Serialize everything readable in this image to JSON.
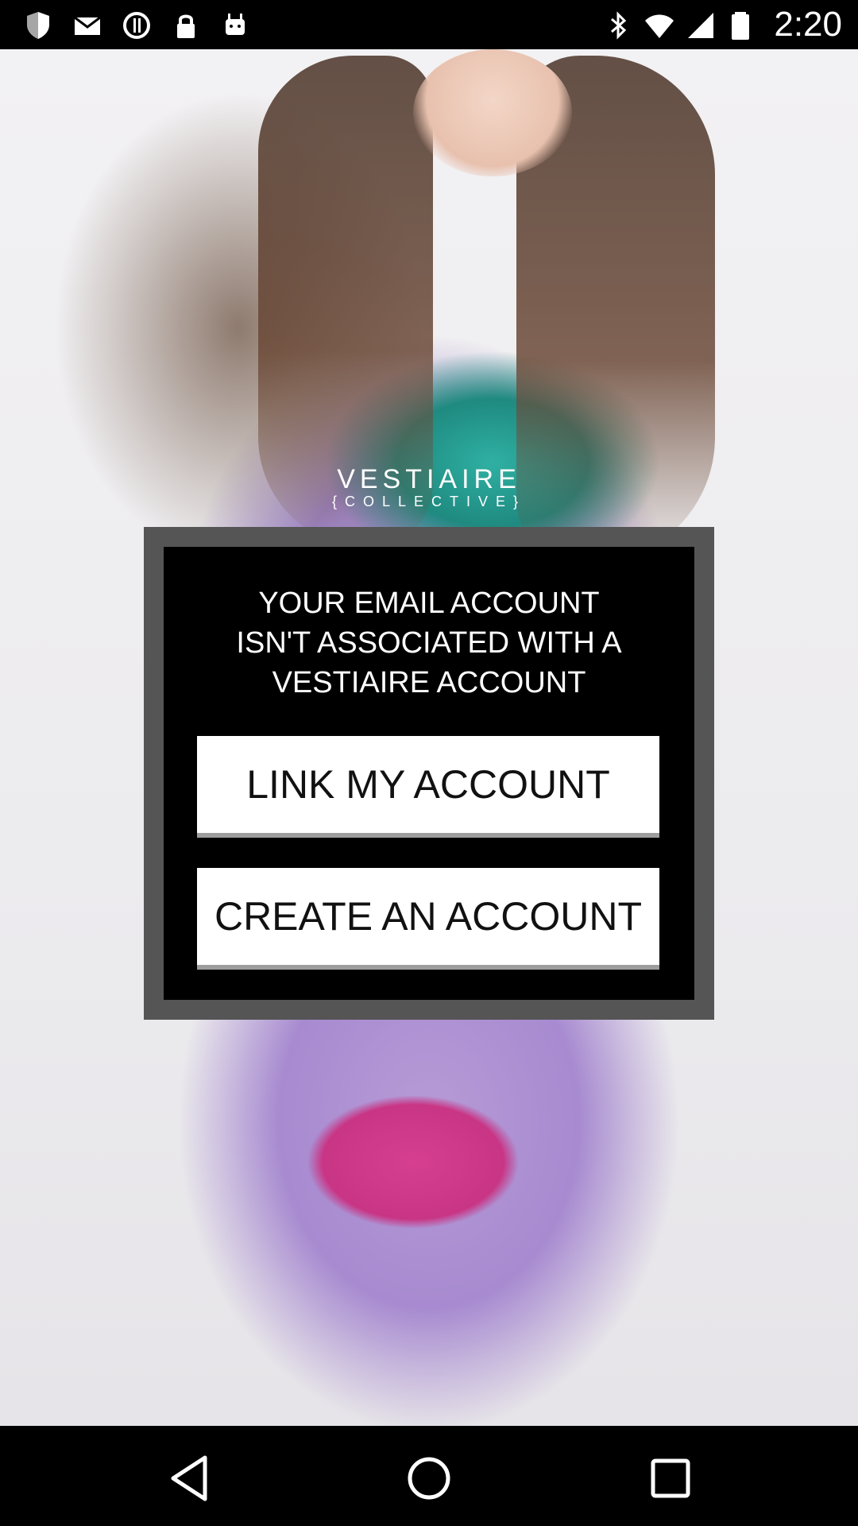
{
  "status_bar": {
    "time": "2:20",
    "icons_left": [
      "shield-icon",
      "email-icon",
      "sync-icon",
      "lock-icon",
      "android-icon"
    ],
    "icons_right": [
      "bluetooth-icon",
      "wifi-icon",
      "signal-icon",
      "battery-icon"
    ]
  },
  "brand": {
    "name": "VESTIAIRE",
    "subtitle": "{COLLECTIVE}"
  },
  "dialog": {
    "message": "YOUR EMAIL ACCOUNT\nISN'T ASSOCIATED WITH A\nVESTIAIRE ACCOUNT",
    "link_button_label": "LINK MY ACCOUNT",
    "create_button_label": "CREATE AN ACCOUNT"
  },
  "nav_bar": {
    "buttons": [
      "back-icon",
      "home-icon",
      "recents-icon"
    ]
  },
  "colors": {
    "dialog_bg": "#000000",
    "dialog_frame": "#555555",
    "button_bg": "#ffffff",
    "text_on_dark": "#ffffff"
  }
}
